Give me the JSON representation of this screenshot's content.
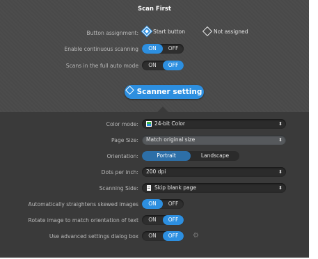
{
  "window": {
    "title": "Scan First"
  },
  "top": {
    "button_assignment": {
      "label": "Button assignment:",
      "options": [
        {
          "label": "Start button",
          "selected": true
        },
        {
          "label": "Not assigned",
          "selected": false
        }
      ]
    },
    "continuous_scanning": {
      "label": "Enable continuous scanning",
      "on": "ON",
      "off": "OFF",
      "value": "ON"
    },
    "full_auto_mode": {
      "label": "Scans in the full auto mode",
      "on": "ON",
      "off": "OFF",
      "value": "OFF"
    }
  },
  "section_button": {
    "label": "Scanner setting"
  },
  "settings": {
    "color_mode": {
      "label": "Color mode:",
      "value": "24-bit Color",
      "icon": "color-mode-icon"
    },
    "page_size": {
      "label": "Page Size:",
      "value": "Match original size"
    },
    "orientation": {
      "label": "Orientation:",
      "options": [
        "Portrait",
        "Landscape"
      ],
      "value": "Portrait"
    },
    "dpi": {
      "label": "Dots per inch:",
      "value": "200 dpi"
    },
    "scanning_side": {
      "label": "Scanning Side:",
      "value": "Skip blank page",
      "icon": "page-icon"
    },
    "straighten": {
      "label": "Automatically straightens skewed images",
      "on": "ON",
      "off": "OFF",
      "value": "ON"
    },
    "rotate": {
      "label": "Rotate image to match orientation of text",
      "on": "ON",
      "off": "OFF",
      "value": "OFF"
    },
    "advanced": {
      "label": "Use advanced settings dialog box",
      "on": "ON",
      "off": "OFF",
      "value": "OFF"
    }
  },
  "colors": {
    "accent": "#2d8fe0",
    "panel": "#4a4a4a",
    "lower_panel": "#3a3a3a"
  }
}
